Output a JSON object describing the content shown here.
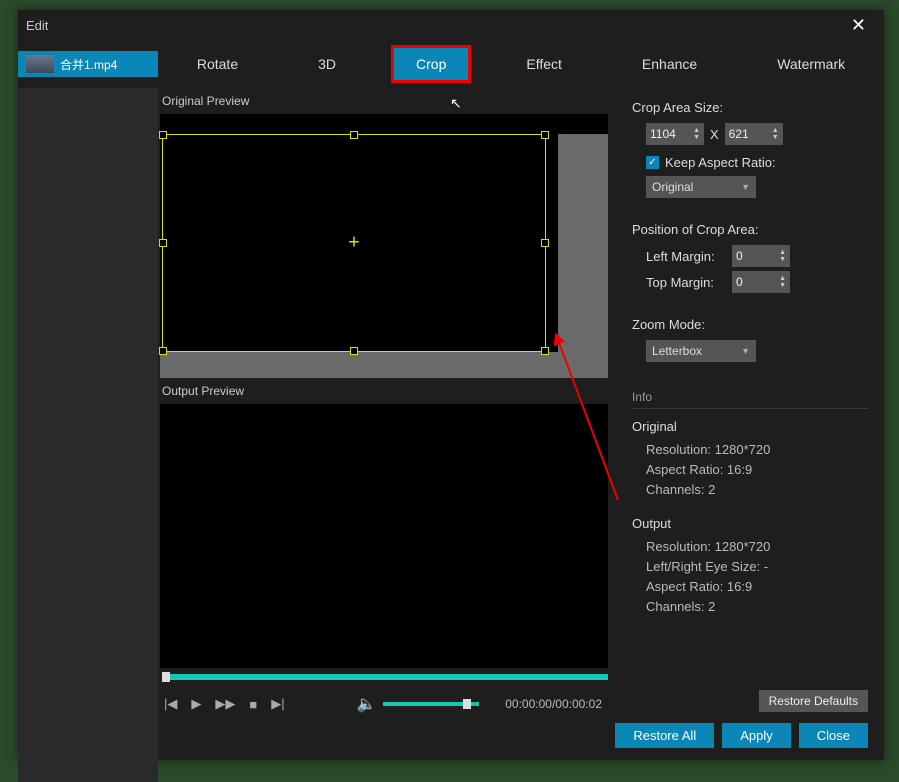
{
  "window": {
    "title": "Edit"
  },
  "file_tab": {
    "name": "合并1.mp4"
  },
  "tabs": {
    "rotate": "Rotate",
    "threed": "3D",
    "crop": "Crop",
    "effect": "Effect",
    "enhance": "Enhance",
    "watermark": "Watermark"
  },
  "preview": {
    "original_label": "Original Preview",
    "output_label": "Output Preview"
  },
  "timecode": "00:00:00/00:00:02",
  "crop_area": {
    "label": "Crop Area Size:",
    "width": "1104",
    "by": "X",
    "height": "621",
    "keep_ratio_label": "Keep Aspect Ratio:",
    "ratio_value": "Original"
  },
  "position": {
    "label": "Position of Crop Area:",
    "left_label": "Left Margin:",
    "left_value": "0",
    "top_label": "Top Margin:",
    "top_value": "0"
  },
  "zoom": {
    "label": "Zoom Mode:",
    "value": "Letterbox"
  },
  "info": {
    "header": "Info",
    "original": {
      "title": "Original",
      "resolution": "Resolution: 1280*720",
      "aspect": "Aspect Ratio: 16:9",
      "channels": "Channels: 2"
    },
    "output": {
      "title": "Output",
      "resolution": "Resolution: 1280*720",
      "lr_eye": "Left/Right Eye Size: -",
      "aspect": "Aspect Ratio: 16:9",
      "channels": "Channels: 2"
    }
  },
  "buttons": {
    "restore_defaults": "Restore Defaults",
    "restore_all": "Restore All",
    "apply": "Apply",
    "close": "Close"
  }
}
